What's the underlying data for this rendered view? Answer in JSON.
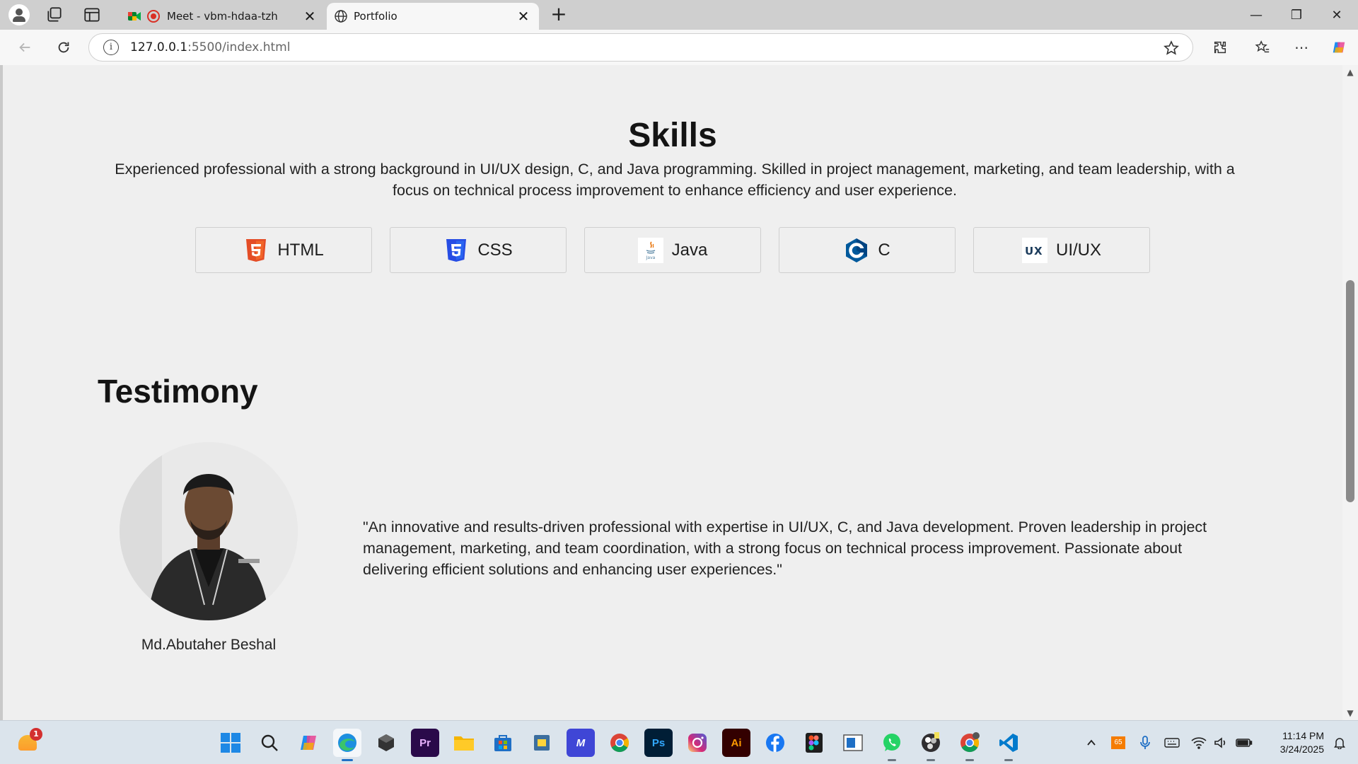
{
  "browser": {
    "tabs": [
      {
        "title": "Meet - vbm-hdaa-tzh",
        "active": false
      },
      {
        "title": "Portfolio",
        "active": true
      }
    ],
    "url_host": "127.0.0.1",
    "url_path": ":5500/index.html"
  },
  "skills": {
    "title": "Skills",
    "description": "Experienced professional with a strong background in UI/UX design, C, and Java programming. Skilled in project management, marketing, and team leadership, with a focus on technical process improvement to enhance efficiency and user experience.",
    "items": [
      {
        "label": "HTML",
        "icon": "html5-icon"
      },
      {
        "label": "CSS",
        "icon": "css3-icon"
      },
      {
        "label": "Java",
        "icon": "java-icon"
      },
      {
        "label": "C",
        "icon": "c-language-icon"
      },
      {
        "label": "UI/UX",
        "icon": "ux-icon"
      }
    ]
  },
  "testimony": {
    "title": "Testimony",
    "name": "Md.Abutaher Beshal",
    "quote": "\"An innovative and results-driven professional with expertise in UI/UX, C, and Java development. Proven leadership in project management, marketing, and team coordination, with a strong focus on technical process improvement. Passionate about delivering efficient solutions and enhancing user experiences.\""
  },
  "taskbar": {
    "weather_badge": "1",
    "apps": [
      "start",
      "search",
      "copilot",
      "edge",
      "unity",
      "premiere",
      "explorer",
      "store",
      "python",
      "affinity",
      "chrome",
      "photoshop",
      "instagram",
      "illustrator",
      "facebook",
      "figma",
      "app",
      "whatsapp",
      "obs",
      "chrome-2",
      "vscode"
    ],
    "tray_badge": "65",
    "time": "11:14 PM",
    "date": "3/24/2025"
  },
  "colors": {
    "page_bg": "#efefef",
    "html_orange": "#e44d26",
    "css_blue": "#264de4",
    "c_blue": "#00599c"
  }
}
